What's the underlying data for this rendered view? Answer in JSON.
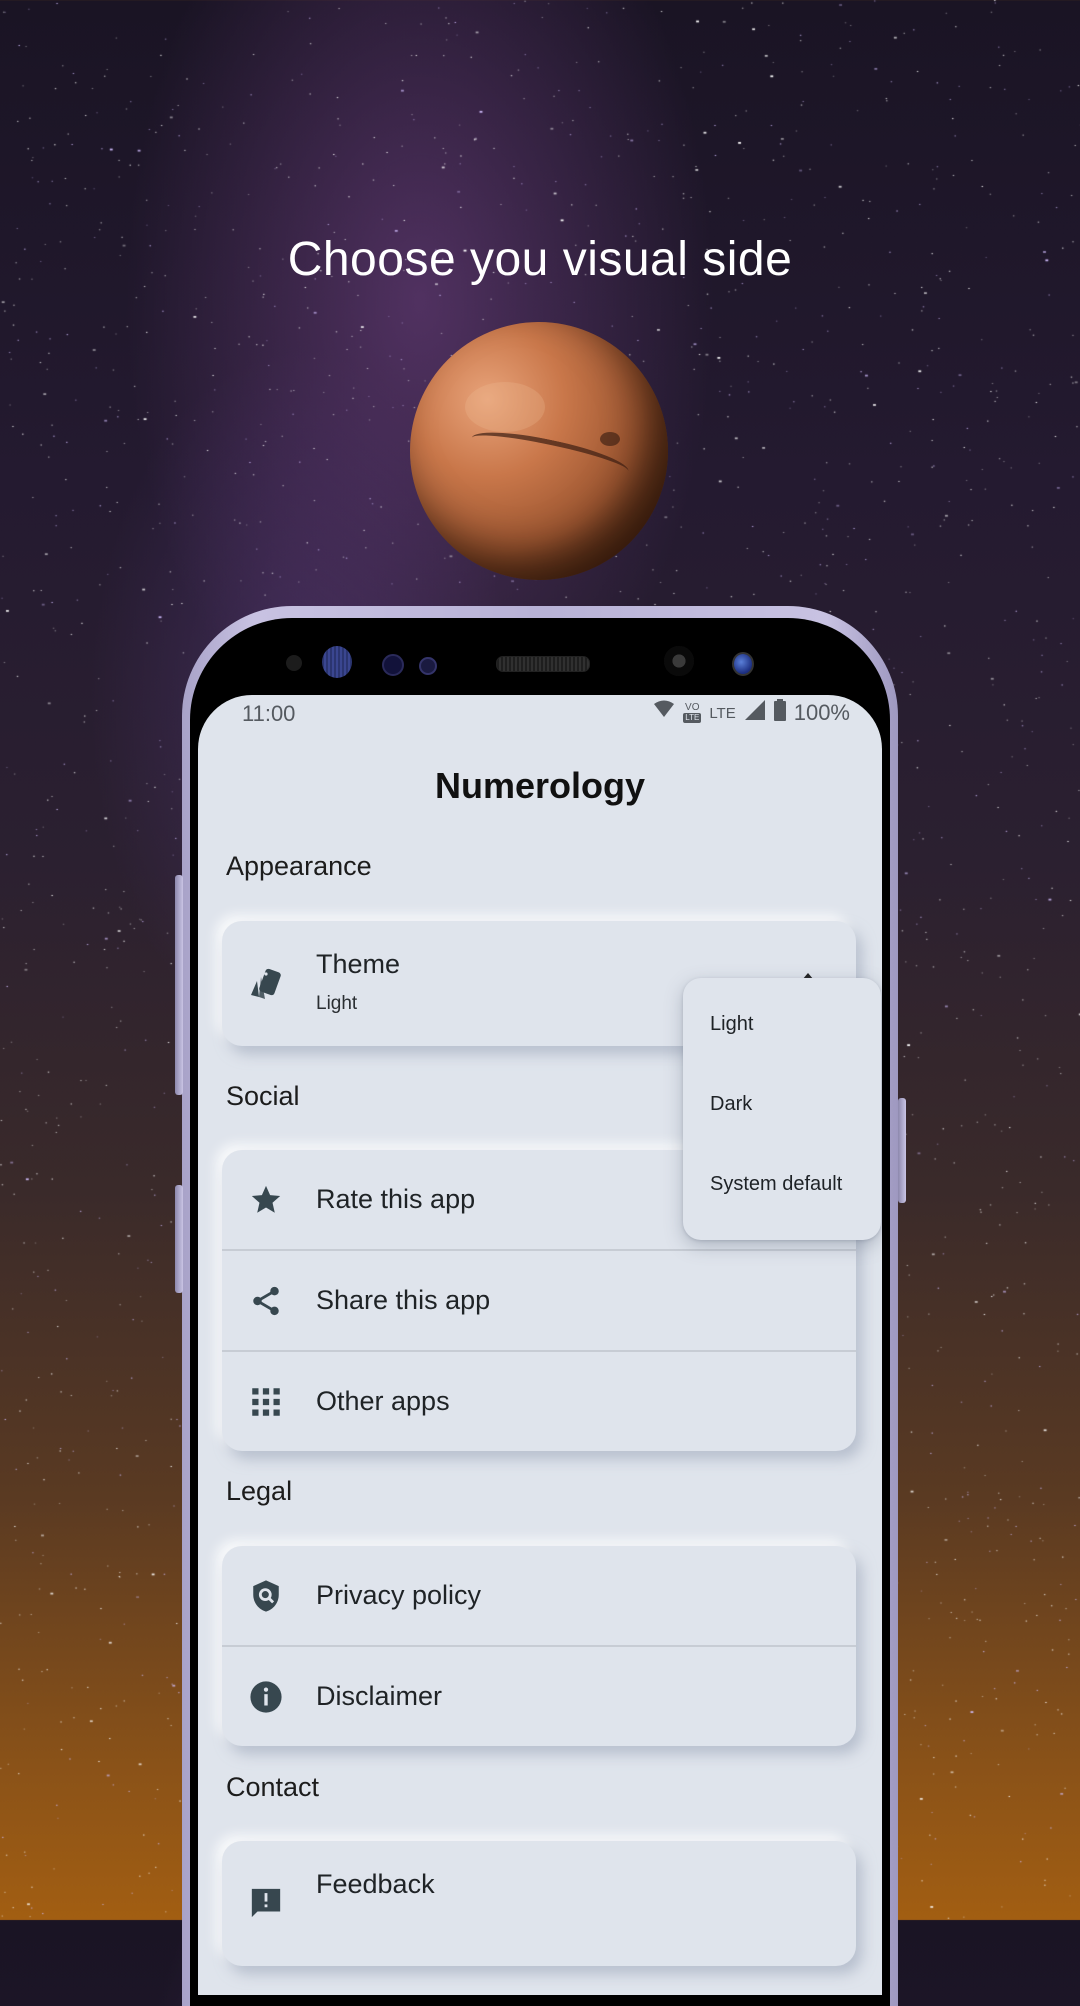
{
  "promo": {
    "headline": "Choose you visual side"
  },
  "status_bar": {
    "time": "11:00",
    "network_label": "LTE",
    "volte_label": "LTE",
    "battery_text": "100%",
    "icons": [
      "wifi-icon",
      "volte-icon",
      "lte-icon",
      "signal-icon",
      "battery-icon"
    ]
  },
  "app": {
    "title": "Numerology"
  },
  "sections": {
    "appearance": {
      "label": "Appearance",
      "items": [
        {
          "icon": "theme-swatch-icon",
          "label": "Theme",
          "value": "Light"
        }
      ]
    },
    "social": {
      "label": "Social",
      "items": [
        {
          "icon": "star-icon",
          "label": "Rate this app"
        },
        {
          "icon": "share-icon",
          "label": "Share this app"
        },
        {
          "icon": "apps-grid-icon",
          "label": "Other apps"
        }
      ]
    },
    "legal": {
      "label": "Legal",
      "items": [
        {
          "icon": "privacy-shield-icon",
          "label": "Privacy policy"
        },
        {
          "icon": "info-icon",
          "label": "Disclaimer"
        }
      ]
    },
    "contact": {
      "label": "Contact",
      "items": [
        {
          "icon": "feedback-icon",
          "label": "Feedback"
        }
      ]
    }
  },
  "theme_menu": {
    "options": [
      "Light",
      "Dark",
      "System default"
    ],
    "selected": "Light"
  },
  "colors": {
    "screen_bg": "#dfe4ec",
    "icon": "#37474f",
    "text": "#1f2326",
    "divider": "#c7ccd4"
  }
}
